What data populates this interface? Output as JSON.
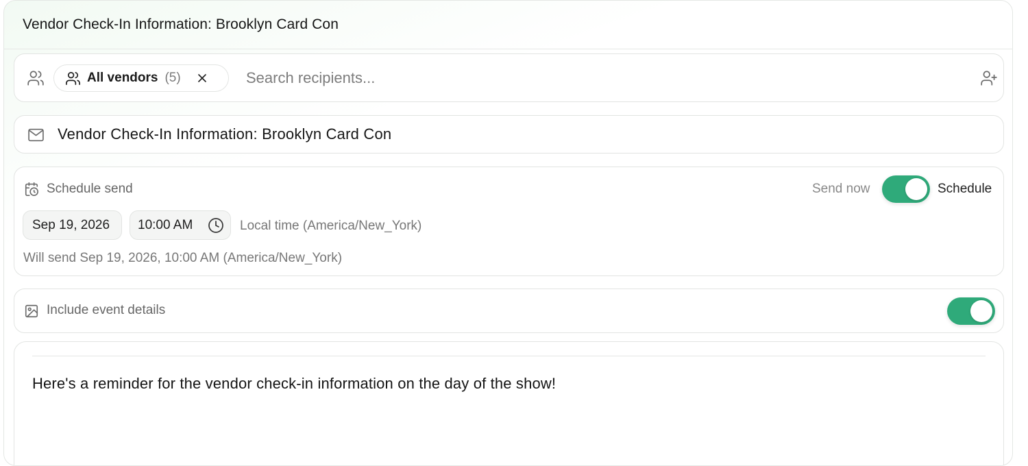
{
  "header": {
    "title": "Vendor Check-In Information: Brooklyn Card Con"
  },
  "recipients": {
    "icon": "users-icon",
    "chip": {
      "label": "All vendors",
      "count": "(5)",
      "icon": "users-icon",
      "remove_icon": "close-icon"
    },
    "search": {
      "placeholder": "Search recipients...",
      "value": ""
    },
    "add_icon": "add-user-icon"
  },
  "subject": {
    "icon": "mail-icon",
    "value": "Vendor Check-In Information: Brooklyn Card Con"
  },
  "schedule": {
    "icon": "calendar-clock-icon",
    "label": "Schedule send",
    "left_option": "Send now",
    "right_option": "Schedule",
    "toggle_on": true,
    "date": "Sep 19, 2026",
    "time": "10:00 AM",
    "timezone_note": "Local time (America/New_York)",
    "summary": "Will send Sep 19, 2026, 10:00 AM (America/New_York)"
  },
  "event_details": {
    "icon": "image-icon",
    "label": "Include event details",
    "toggle_on": true
  },
  "message": {
    "body": "Here's a reminder for the vendor check-in information on the day of the show!"
  },
  "colors": {
    "accent": "#2faa7a",
    "border": "#e2e4e2",
    "muted_text": "#777777"
  }
}
